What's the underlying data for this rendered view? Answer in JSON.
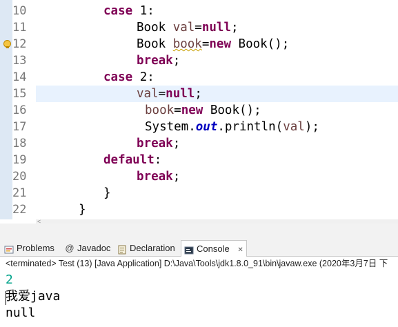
{
  "editor": {
    "line_numbers": [
      "10",
      "11",
      "12",
      "13",
      "14",
      "15",
      "16",
      "17",
      "18",
      "19",
      "20",
      "21",
      "22"
    ],
    "code": {
      "l10": {
        "kw": "case",
        "rest": " 1:"
      },
      "l11": {
        "t1": "Book ",
        "v1": "val",
        "t2": "=",
        "kw": "null",
        "t3": ";"
      },
      "l12": {
        "t1": "Book ",
        "v1": "book",
        "t2": "=",
        "kw": "new",
        "t3": " Book();"
      },
      "l13": {
        "kw": "break",
        "t1": ";"
      },
      "l14": {
        "kw": "case",
        "rest": " 2:"
      },
      "l15": {
        "v1": "val",
        "t1": "=",
        "kw": "null",
        "t2": ";"
      },
      "l16": {
        "v1": "book",
        "t1": "=",
        "kw": "new",
        "t2": " Book();"
      },
      "l17": {
        "t1": "System.",
        "f1": "out",
        "t2": ".println(",
        "v1": "val",
        "t3": ");"
      },
      "l18": {
        "kw": "break",
        "t1": ";"
      },
      "l19": {
        "kw": "default",
        "t1": ":"
      },
      "l20": {
        "kw": "break",
        "t1": ";"
      },
      "l21": {
        "t1": "}"
      },
      "l22": {
        "t1": "}"
      }
    },
    "scroll_arrow": "<"
  },
  "tabs": [
    {
      "label": "Problems",
      "icon": "problems-icon",
      "close": ""
    },
    {
      "label": "Javadoc",
      "icon": "javadoc-icon",
      "close": ""
    },
    {
      "label": "Declaration",
      "icon": "declaration-icon",
      "close": ""
    },
    {
      "label": "Console",
      "icon": "console-icon",
      "close": "✕"
    }
  ],
  "console": {
    "status": "<terminated> Test (13) [Java Application] D:\\Java\\Tools\\jdk1.8.0_91\\bin\\javaw.exe (2020年3月7日 下",
    "output": [
      "2",
      "我爱java",
      "null"
    ]
  },
  "colors": {
    "keyword": "#7f0055",
    "variable": "#6a3e3e",
    "field": "#0000c0",
    "console_number": "#00a38a"
  }
}
